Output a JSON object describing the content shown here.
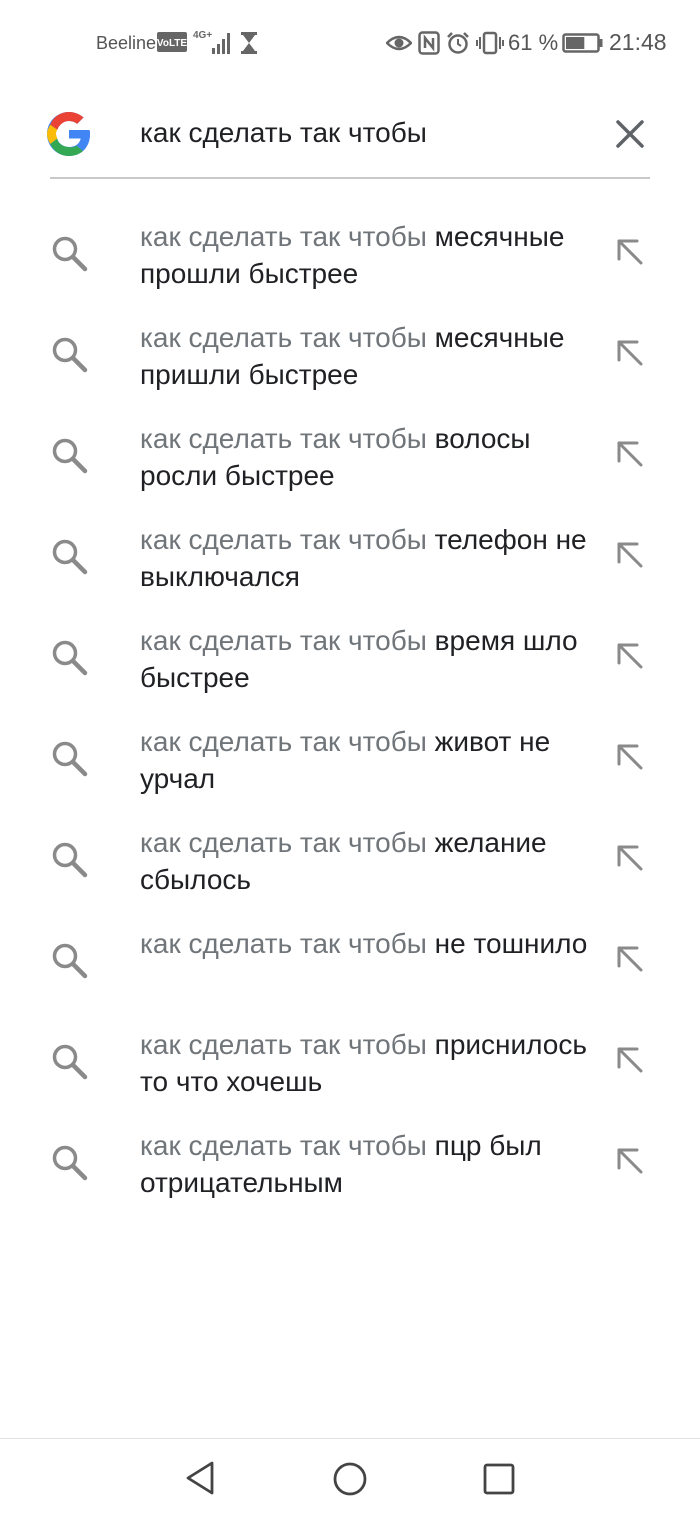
{
  "status_bar": {
    "carrier": "Beeline",
    "volte": "VoLTE",
    "network": "4G+",
    "battery_percent": "61 %",
    "battery_level": 0.61,
    "time": "21:48",
    "icons": [
      "hourglass-icon",
      "eye-icon",
      "nfc-icon",
      "alarm-icon",
      "vibrate-icon",
      "battery-icon"
    ]
  },
  "search": {
    "query": "как сделать так чтобы",
    "logo": "google-logo",
    "clear_icon": "close-icon"
  },
  "suggestions": [
    {
      "prefix": "как сделать так чтобы",
      "rest": "месячные прошли быстрее"
    },
    {
      "prefix": "как сделать так чтобы",
      "rest": "месячные пришли быстрее"
    },
    {
      "prefix": "как сделать так чтобы",
      "rest": "волосы росли быстрее"
    },
    {
      "prefix": "как сделать так чтобы",
      "rest": "телефон не выключался"
    },
    {
      "prefix": "как сделать так чтобы",
      "rest": "время шло быстрее"
    },
    {
      "prefix": "как сделать так чтобы",
      "rest": "живот не урчал"
    },
    {
      "prefix": "как сделать так чтобы",
      "rest": "желание сбылось"
    },
    {
      "prefix": "как сделать так чтобы",
      "rest": "не тошнило"
    },
    {
      "prefix": "как сделать так чтобы",
      "rest": "приснилось то что хочешь"
    },
    {
      "prefix": "как сделать так чтобы",
      "rest": "пцр был отрицательным"
    }
  ],
  "nav_bar": {
    "icons": [
      "back-icon",
      "home-icon",
      "recents-icon"
    ]
  },
  "colors": {
    "prefix_text": "#70757a",
    "main_text": "#202124",
    "icon_gray": "#7a7a7a"
  }
}
